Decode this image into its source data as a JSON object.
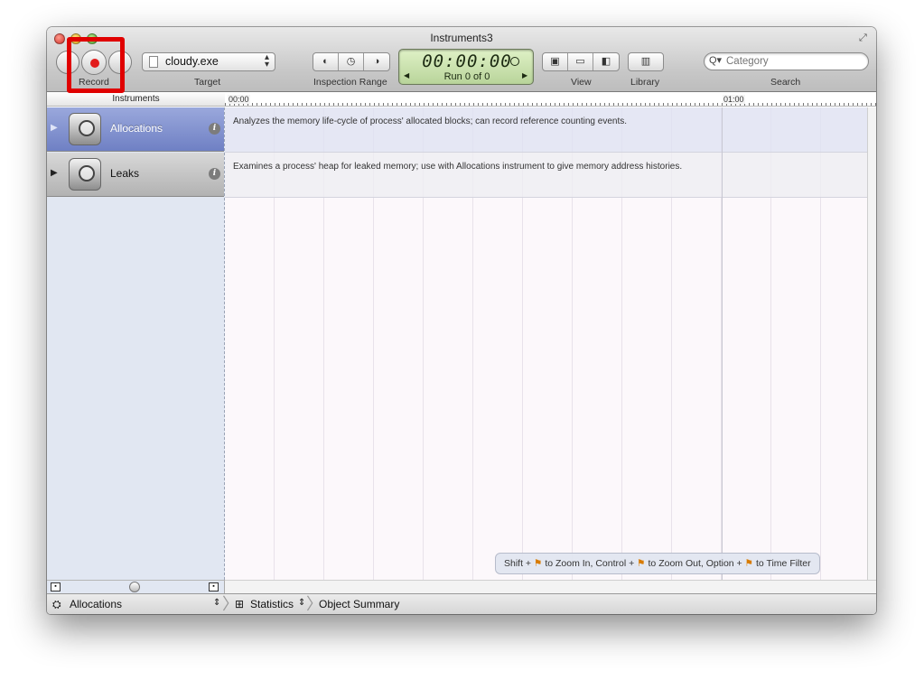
{
  "window": {
    "title": "Instruments3"
  },
  "toolbar": {
    "record_label": "Record",
    "target_label": "Target",
    "target_value": "cloudy.exe",
    "inspection_range_label": "Inspection Range",
    "timer": "00:00:00",
    "run_text": "Run 0 of 0",
    "view_label": "View",
    "library_label": "Library",
    "search_label": "Search",
    "search_placeholder": "Category"
  },
  "sidebar": {
    "header": "Instruments",
    "items": [
      {
        "name": "Allocations",
        "selected": true
      },
      {
        "name": "Leaks",
        "selected": false
      }
    ]
  },
  "timeline": {
    "ruler_start": "00:00",
    "ruler_mark": "01:00",
    "tracks": [
      {
        "description": "Analyzes the memory life-cycle of process' allocated blocks; can record reference counting events."
      },
      {
        "description": "Examines a process' heap for leaked memory; use with Allocations instrument to give memory address histories."
      }
    ],
    "hint": {
      "p1": "Shift +",
      "p2": "to Zoom In, Control +",
      "p3": "to Zoom Out, Option +",
      "p4": "to Time Filter"
    }
  },
  "statusbar": {
    "instrument": "Allocations",
    "view": "Statistics",
    "detail": "Object Summary"
  },
  "colors": {
    "highlight": "#e00000",
    "record": "#e21b1b",
    "selected_row": "#7a8acb"
  }
}
